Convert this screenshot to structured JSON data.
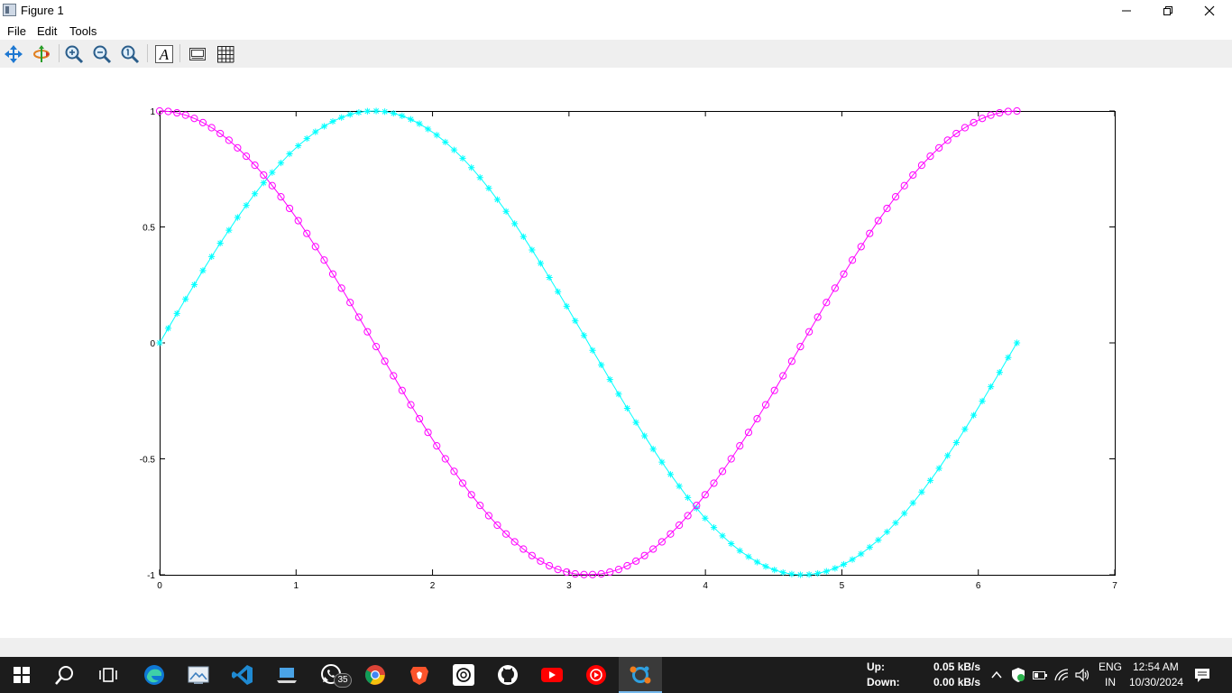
{
  "window": {
    "title": "Figure 1"
  },
  "menu": {
    "file_label": "File",
    "edit_label": "Edit",
    "tools_label": "Tools"
  },
  "toolbar": {
    "tools": [
      "pan-icon",
      "rotate-icon",
      "zoom-in-icon",
      "zoom-out-icon",
      "zoom-reset-icon",
      "text-insert-icon",
      "axes-toggle-icon",
      "grid-toggle-icon"
    ]
  },
  "chart_data": {
    "type": "line",
    "title": "",
    "xlabel": "",
    "ylabel": "",
    "xlim": [
      0,
      7
    ],
    "ylim": [
      -1,
      1
    ],
    "x_ticks": [
      "0",
      "1",
      "2",
      "3",
      "4",
      "5",
      "6",
      "7"
    ],
    "y_ticks": [
      "-1",
      "-0.5",
      "0",
      "0.5",
      "1"
    ],
    "grid": false,
    "x": [
      0,
      0.063,
      0.127,
      0.19,
      0.254,
      0.317,
      0.381,
      0.444,
      0.508,
      0.571,
      0.635,
      0.698,
      0.762,
      0.825,
      0.889,
      0.952,
      1.016,
      1.079,
      1.142,
      1.206,
      1.269,
      1.333,
      1.396,
      1.46,
      1.523,
      1.587,
      1.65,
      1.714,
      1.777,
      1.841,
      1.904,
      1.967,
      2.031,
      2.094,
      2.158,
      2.221,
      2.285,
      2.348,
      2.412,
      2.475,
      2.539,
      2.602,
      2.666,
      2.729,
      2.792,
      2.856,
      2.919,
      2.983,
      3.046,
      3.11,
      3.173,
      3.237,
      3.3,
      3.364,
      3.427,
      3.491,
      3.554,
      3.617,
      3.681,
      3.744,
      3.808,
      3.871,
      3.935,
      3.998,
      4.062,
      4.125,
      4.189,
      4.252,
      4.316,
      4.379,
      4.442,
      4.506,
      4.569,
      4.633,
      4.696,
      4.76,
      4.823,
      4.887,
      4.95,
      5.014,
      5.077,
      5.141,
      5.204,
      5.267,
      5.331,
      5.394,
      5.458,
      5.521,
      5.585,
      5.648,
      5.712,
      5.775,
      5.839,
      5.902,
      5.966,
      6.029,
      6.092,
      6.156,
      6.219,
      6.283
    ],
    "series": [
      {
        "color": "#00ffff",
        "marker": "asterisk",
        "values": [
          0,
          0.063,
          0.127,
          0.189,
          0.251,
          0.312,
          0.372,
          0.43,
          0.486,
          0.541,
          0.593,
          0.643,
          0.69,
          0.735,
          0.776,
          0.815,
          0.85,
          0.881,
          0.91,
          0.934,
          0.955,
          0.972,
          0.985,
          0.994,
          0.999,
          1,
          0.997,
          0.99,
          0.979,
          0.964,
          0.945,
          0.922,
          0.896,
          0.866,
          0.832,
          0.796,
          0.756,
          0.713,
          0.667,
          0.618,
          0.567,
          0.514,
          0.458,
          0.401,
          0.343,
          0.282,
          0.221,
          0.158,
          0.095,
          0.032,
          -0.032,
          -0.095,
          -0.158,
          -0.221,
          -0.282,
          -0.343,
          -0.401,
          -0.458,
          -0.514,
          -0.567,
          -0.618,
          -0.667,
          -0.713,
          -0.756,
          -0.796,
          -0.832,
          -0.866,
          -0.896,
          -0.922,
          -0.945,
          -0.964,
          -0.979,
          -0.99,
          -0.997,
          -1,
          -0.999,
          -0.994,
          -0.985,
          -0.972,
          -0.955,
          -0.934,
          -0.91,
          -0.881,
          -0.85,
          -0.815,
          -0.776,
          -0.735,
          -0.69,
          -0.643,
          -0.593,
          -0.541,
          -0.486,
          -0.43,
          -0.372,
          -0.312,
          -0.251,
          -0.189,
          -0.127,
          -0.063,
          0
        ]
      },
      {
        "color": "#ff00ff",
        "marker": "circle",
        "values": [
          1,
          0.998,
          0.992,
          0.982,
          0.968,
          0.95,
          0.928,
          0.903,
          0.874,
          0.841,
          0.805,
          0.766,
          0.724,
          0.678,
          0.63,
          0.58,
          0.527,
          0.472,
          0.415,
          0.357,
          0.297,
          0.236,
          0.174,
          0.111,
          0.048,
          -0.016,
          -0.079,
          -0.142,
          -0.205,
          -0.267,
          -0.327,
          -0.386,
          -0.444,
          -0.5,
          -0.554,
          -0.605,
          -0.655,
          -0.701,
          -0.745,
          -0.786,
          -0.824,
          -0.858,
          -0.889,
          -0.917,
          -0.941,
          -0.961,
          -0.977,
          -0.988,
          -0.996,
          -0.999,
          -0.999,
          -0.996,
          -0.988,
          -0.977,
          -0.961,
          -0.941,
          -0.917,
          -0.889,
          -0.858,
          -0.824,
          -0.786,
          -0.745,
          -0.701,
          -0.655,
          -0.605,
          -0.554,
          -0.5,
          -0.444,
          -0.386,
          -0.327,
          -0.267,
          -0.205,
          -0.142,
          -0.079,
          -0.016,
          0.048,
          0.111,
          0.174,
          0.236,
          0.297,
          0.357,
          0.415,
          0.472,
          0.527,
          0.58,
          0.63,
          0.678,
          0.724,
          0.766,
          0.805,
          0.841,
          0.874,
          0.903,
          0.928,
          0.95,
          0.968,
          0.982,
          0.992,
          0.998,
          1
        ]
      }
    ]
  },
  "taskbar": {
    "icons": [
      "start-icon",
      "search-icon",
      "task-view-icon",
      "edge-icon",
      "photos-icon",
      "vscode-icon",
      "laptop-icon",
      "whatsapp-icon",
      "chrome-icon",
      "brave-icon",
      "chatgpt-icon",
      "github-icon",
      "youtube-icon",
      "youtube-music-icon",
      "octave-icon"
    ],
    "whatsapp_badge": "35",
    "net": {
      "up_label": "Up:",
      "down_label": "Down:",
      "up_value": "0.05 kB/s",
      "down_value": "0.00 kB/s"
    },
    "lang_top": "ENG",
    "lang_bottom": "IN",
    "time": "12:54 AM",
    "date": "10/30/2024"
  }
}
